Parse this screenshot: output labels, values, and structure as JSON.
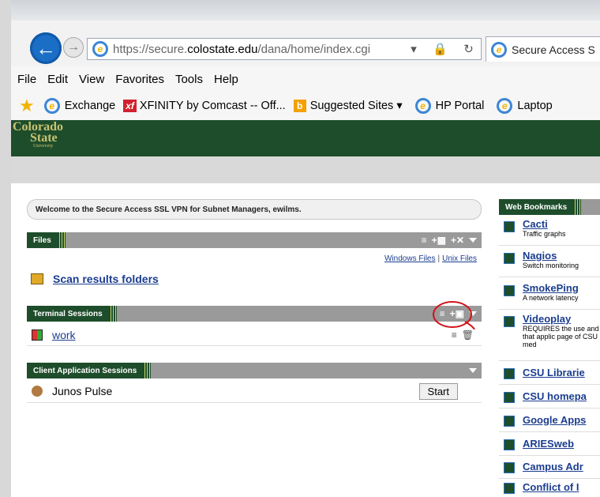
{
  "browser": {
    "url_prefix": "https://secure.",
    "url_domain": "colostate.edu",
    "url_path": "/dana/home/index.cgi",
    "tab_title": "Secure Access S",
    "menu": [
      "File",
      "Edit",
      "View",
      "Favorites",
      "Tools",
      "Help"
    ],
    "favorites": [
      {
        "label": "Exchange",
        "icon": "ie-icon"
      },
      {
        "label": "XFINITY by Comcast -- Off...",
        "icon": "xfinity-icon"
      },
      {
        "label": "Suggested Sites ▾",
        "icon": "bing-icon"
      },
      {
        "label": "HP Portal",
        "icon": "ie-icon"
      },
      {
        "label": "Laptop",
        "icon": "ie-icon"
      }
    ]
  },
  "header": {
    "logo_line1": "Colorado",
    "logo_line2": "State",
    "logo_line3": "University"
  },
  "welcome_text": "Welcome to the Secure Access SSL VPN for Subnet Managers, ewilms.",
  "files": {
    "title": "Files",
    "windows_files": "Windows Files",
    "separator": "|",
    "unix_files": "Unix Files",
    "items": [
      {
        "label": "Scan results folders"
      }
    ]
  },
  "terminal": {
    "title": "Terminal Sessions",
    "items": [
      {
        "label": "work"
      }
    ]
  },
  "client_apps": {
    "title": "Client Application Sessions",
    "items": [
      {
        "label": "Junos Pulse",
        "action": "Start"
      }
    ]
  },
  "bookmarks": {
    "title": "Web Bookmarks",
    "items": [
      {
        "title": "Cacti",
        "desc": "Traffic graphs"
      },
      {
        "title": "Nagios",
        "desc": "Switch monitoring"
      },
      {
        "title": "SmokePing",
        "desc": "A network latency"
      },
      {
        "title": "Videoplay",
        "desc": "REQUIRES the use and let that applic page of CSU med"
      },
      {
        "title": "CSU Librarie",
        "desc": ""
      },
      {
        "title": "CSU homepa",
        "desc": ""
      },
      {
        "title": "Google Apps",
        "desc": ""
      },
      {
        "title": "ARIESweb",
        "desc": ""
      },
      {
        "title": "Campus Adr",
        "desc": ""
      },
      {
        "title": "Conflict of I",
        "desc": ""
      }
    ]
  },
  "colors": {
    "csu_green": "#1e4d2b",
    "csu_gold": "#c8c372",
    "link_blue": "#1b3d8f"
  }
}
